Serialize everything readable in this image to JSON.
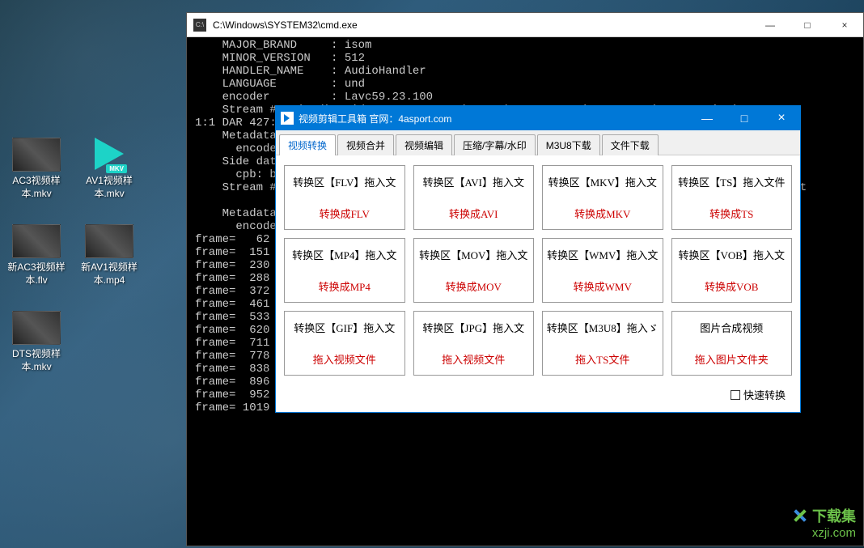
{
  "desktop": {
    "icons": [
      {
        "label": "AC3视频样本.mkv",
        "type": "thumb"
      },
      {
        "label": "AV1视频样本.mkv",
        "type": "play",
        "badge": "MKV"
      },
      {
        "label": "新AC3视频样本.flv",
        "type": "thumb"
      },
      {
        "label": "新AV1视频样本.mp4",
        "type": "thumb"
      },
      {
        "label": "DTS视频样本.mkv",
        "type": "thumb"
      }
    ]
  },
  "cmd": {
    "title": "C:\\Windows\\SYSTEM32\\cmd.exe",
    "min_label": "—",
    "max_label": "□",
    "close_label": "×",
    "body": "    MAJOR_BRAND     : isom\n    MINOR_VERSION   : 512\n    HANDLER_NAME    : AudioHandler\n    LANGUAGE        : und\n    encoder         : Lavc59.23.100\n    Stream #0:0(und): Video: msmpeg4v3 (DIV3 / 0x33564944), yuv420p(progressive), 854\n1:1 DAR 427:240], q=2-31, 200 kb/s, 24 fps, 24 tbn (default)\n    Metadata:\n      encoder         : Lavc59.23.100 msmpeg4\n    Side data:\n      cpb: bitrate max/min/avg: 0/0/200000 buffer size: 0 vbv_delay: N/A\n    Stream #0:1(und): Audio: mp3, 44100 Hz, stereo, fltp (default)                ono, flt\n\n    Metadata:\n      encoder         : Lavc59.23.100 libmp3lame\nframe=   62 fps=0.0 q=31.0 size=       0kB time=00:00:02.63 bitrate=   0.1kbits/s spe\nframe=  151 fps=150 q=31.0 size=     256kB time=00:00:06.29 bitrate= 333.2kbits/s spe\nframe=  230 fps=152 q=31.0 size=     512kB time=00:00:09.60 bitrate= 436.7kbits/s spe\nframe=  288 fps=142 q=31.0 size=     768kB time=00:00:12.01 bitrate= 523.7kbits/s spe\nframe=  372 fps=147 q=31.0 size=    1024kB time=00:00:15.51 bitrate= 540.8kbits/s spe\nframe=  461 fps=152 q=31.0 size=    1024kB time=00:00:19.22 bitrate= 436.5kbits/s spe\nframe=  533 fps=150 q=31.0 size=    1280kB time=00:00:22.22 bitrate= 471.9kbits/s spe\nframe=  620 fps=153 q=31.0 size=    1536kB time=00:00:25.85 bitrate= 486.7kbits/s spe\nframe=  711 fps=156 q=31.0 size=    1792kB time=00:00:29.64 bitrate= 495.3kbits/s spe\nframe=  778 fps=153 q=31.0 size=    1792kB time=00:00:32.44 bitrate= 452.5kbits/s spe\nframe=  838 fps=150 q=31.0 size=    2048kB time=00:00:34.91 bitrate= 480.6kbits/s spe\nframe=  896 fps=147 q=31.0 size=    2560kB time=00:00:37.33 bitrate= 561.8kbits/s spe\nframe=  952 fps=144 q=31.0 size=    2816kB time=00:00:39.66 bitrate= 581.6kbits/s spe\nframe= 1019 fps=143 q=31.0 size=    3328kB time=00:00:42.46 bitrate= 642.1kbits/s spe"
  },
  "app": {
    "title": "视频剪辑工具箱 官网：4asport.com",
    "min": "—",
    "max": "□",
    "close": "×",
    "tabs": [
      "视频转换",
      "视频合并",
      "视频编辑",
      "压缩/字幕/水印",
      "M3U8下载",
      "文件下载"
    ],
    "active_tab": 0,
    "boxes": [
      [
        {
          "label": "转换区【FLV】拖入文",
          "hint": "转换成FLV"
        },
        {
          "label": "转换区【AVI】拖入文",
          "hint": "转换成AVI"
        },
        {
          "label": "转换区【MKV】拖入文",
          "hint": "转换成MKV"
        },
        {
          "label": "转换区【TS】拖入文件",
          "hint": "转换成TS"
        }
      ],
      [
        {
          "label": "转换区【MP4】拖入文",
          "hint": "转换成MP4"
        },
        {
          "label": "转换区【MOV】拖入文",
          "hint": "转换成MOV"
        },
        {
          "label": "转换区【WMV】拖入文",
          "hint": "转换成WMV"
        },
        {
          "label": "转换区【VOB】拖入文",
          "hint": "转换成VOB"
        }
      ],
      [
        {
          "label": "转换区【GIF】拖入文",
          "hint": "拖入视频文件"
        },
        {
          "label": "转换区【JPG】拖入文",
          "hint": "拖入视频文件"
        },
        {
          "label": "转换区【M3U8】拖入ゞ",
          "hint": "拖入TS文件"
        },
        {
          "label": "图片合成视频",
          "hint": "拖入图片文件夹"
        }
      ]
    ],
    "fast_label": "快速转换"
  },
  "watermark": {
    "name": "下载集",
    "url": "xzji.com"
  }
}
